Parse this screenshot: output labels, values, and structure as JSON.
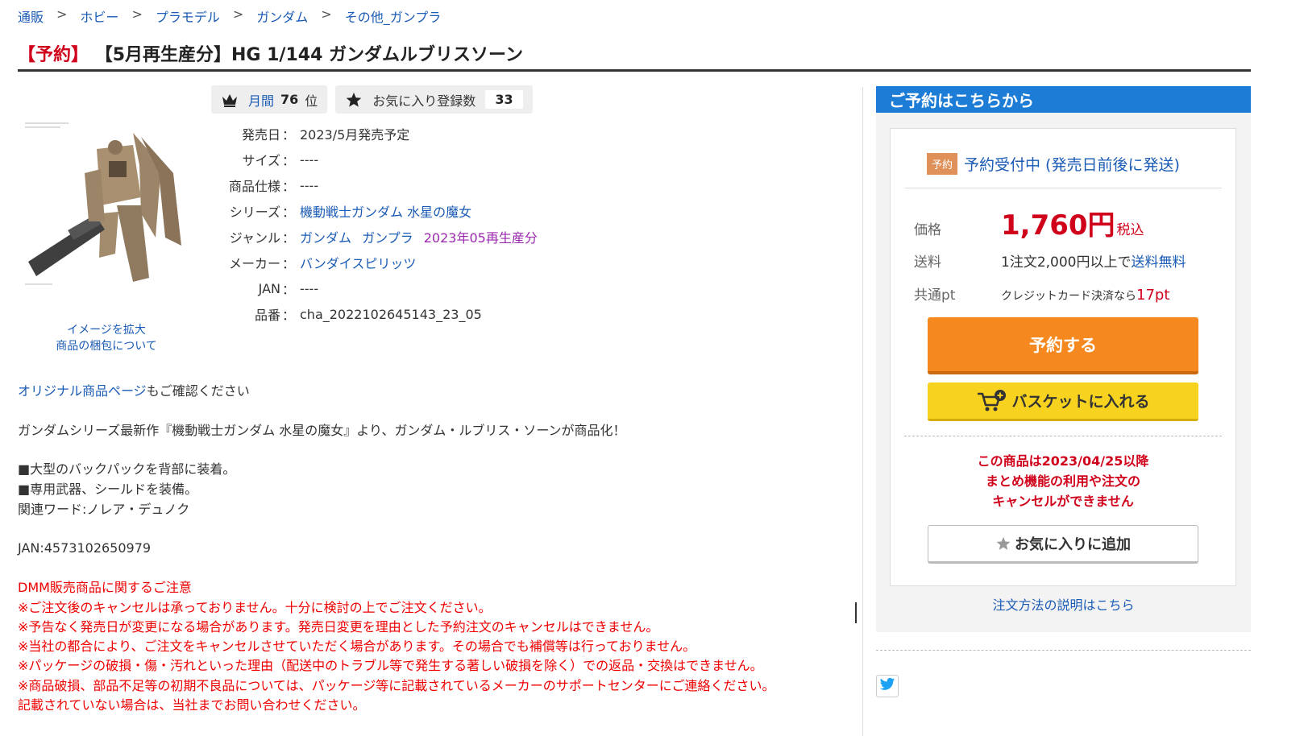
{
  "breadcrumb": [
    "通販",
    "ホビー",
    "プラモデル",
    "ガンダム",
    "その他_ガンプラ"
  ],
  "breadcrumb_sep": ">",
  "title": {
    "reserve": "【予約】",
    "text": "【5月再生産分】HG 1/144 ガンダムルブリスソーン"
  },
  "ranking": {
    "label": "月間",
    "rank": "76",
    "suffix": "位",
    "icon": "crown-icon"
  },
  "favorites": {
    "label": "お気に入り登録数",
    "count": "33",
    "icon": "star-icon"
  },
  "image_links": {
    "enlarge": "イメージを拡大",
    "packaging": "商品の梱包について"
  },
  "specs": {
    "release": {
      "label": "発売日",
      "value": "2023/5月発売予定"
    },
    "size": {
      "label": "サイズ",
      "value": "----"
    },
    "spec": {
      "label": "商品仕様",
      "value": "----"
    },
    "series": {
      "label": "シリーズ",
      "value": "機動戦士ガンダム 水星の魔女"
    },
    "genre": {
      "label": "ジャンル",
      "values": [
        "ガンダム",
        "ガンプラ"
      ],
      "extra": "2023年05再生産分"
    },
    "maker": {
      "label": "メーカー",
      "value": "バンダイスピリッツ"
    },
    "jan": {
      "label": "JAN",
      "value": "----"
    },
    "part": {
      "label": "品番",
      "value": "cha_2022102645143_23_05"
    }
  },
  "colon": "：",
  "description": {
    "original_link": "オリジナル商品ページ",
    "original_suffix": "もご確認ください",
    "intro": "ガンダムシリーズ最新作『機動戦士ガンダム 水星の魔女』より、ガンダム・ルブリス・ソーンが商品化！",
    "bullet1": "■大型のバックパックを背部に装着。",
    "bullet2": "■専用武器、シールドを装備。",
    "related": "関連ワード:ノレア・デュノク",
    "jan": "JAN:4573102650979"
  },
  "notice": [
    "DMM販売商品に関するご注意",
    "※ご注文後のキャンセルは承っておりません。十分に検討の上でご注文ください。",
    "※予告なく発売日が変更になる場合があります。発売日変更を理由とした予約注文のキャンセルはできません。",
    "※当社の都合により、ご注文をキャンセルさせていただく場合があります。その場合でも補償等は行っておりません。",
    "※パッケージの破損・傷・汚れといった理由（配送中のトラブル等で発生する著しい破損を除く）での返品・交換はできません。",
    "※商品破損、部品不足等の初期不良品については、パッケージ等に記載されているメーカーのサポートセンターにご連絡ください。",
    "記載されていない場合は、当社までお問い合わせください。"
  ],
  "sidebar": {
    "header": "ご予約はこちらから",
    "tag": "予約",
    "status": "予約受付中 (発売日前後に発送)",
    "price_label": "価格",
    "price": "1,760円",
    "tax": "税込",
    "shipping_label": "送料",
    "shipping_text": "1注文2,000円以上で",
    "shipping_link": "送料無料",
    "points_label": "共通pt",
    "points_text": "クレジットカード決済なら",
    "points_value": "17pt",
    "reserve_button": "予約する",
    "basket_button": "バスケットに入れる",
    "warning": [
      "この商品は2023/04/25以降",
      "まとめ機能の利用や注文の",
      "キャンセルができません"
    ],
    "favorite_button": "お気に入りに追加",
    "howto": "注文方法の説明はこちら"
  },
  "colors": {
    "accent_blue": "#1c7cd6",
    "link": "#1a5bb5",
    "price_red": "#d0021b",
    "reserve_orange": "#f5891f",
    "basket_yellow": "#f7d21e"
  }
}
